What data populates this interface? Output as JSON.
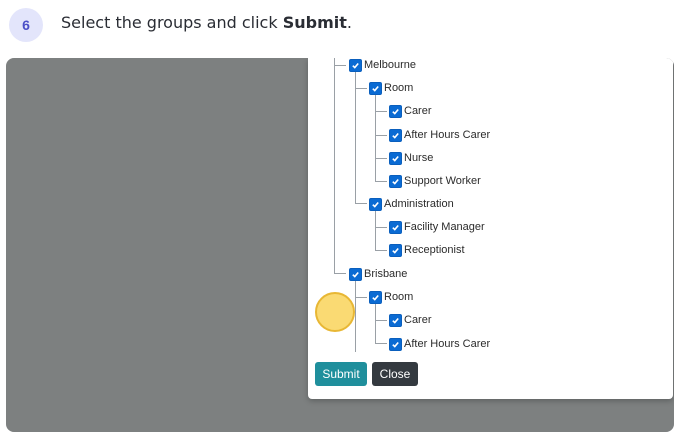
{
  "step": {
    "number": "6",
    "instruction_prefix": "Select the groups and click ",
    "instruction_bold": "Submit",
    "instruction_suffix": "."
  },
  "tree": {
    "melbourne": {
      "label": "Melbourne",
      "checked": true,
      "room": {
        "label": "Room",
        "items": [
          "Carer",
          "After Hours Carer",
          "Nurse",
          "Support Worker"
        ]
      },
      "administration": {
        "label": "Administration",
        "items": [
          "Facility Manager",
          "Receptionist"
        ]
      }
    },
    "brisbane": {
      "label": "Brisbane",
      "checked": true,
      "room": {
        "label": "Room",
        "items": [
          "Carer",
          "After Hours Carer"
        ]
      }
    }
  },
  "buttons": {
    "submit": "Submit",
    "close": "Close"
  },
  "colors": {
    "checkbox": "#0b6bd3",
    "submit": "#1f8f9c",
    "close": "#343a40",
    "highlight": "#f8d04c",
    "overlay": "#7d8080"
  }
}
